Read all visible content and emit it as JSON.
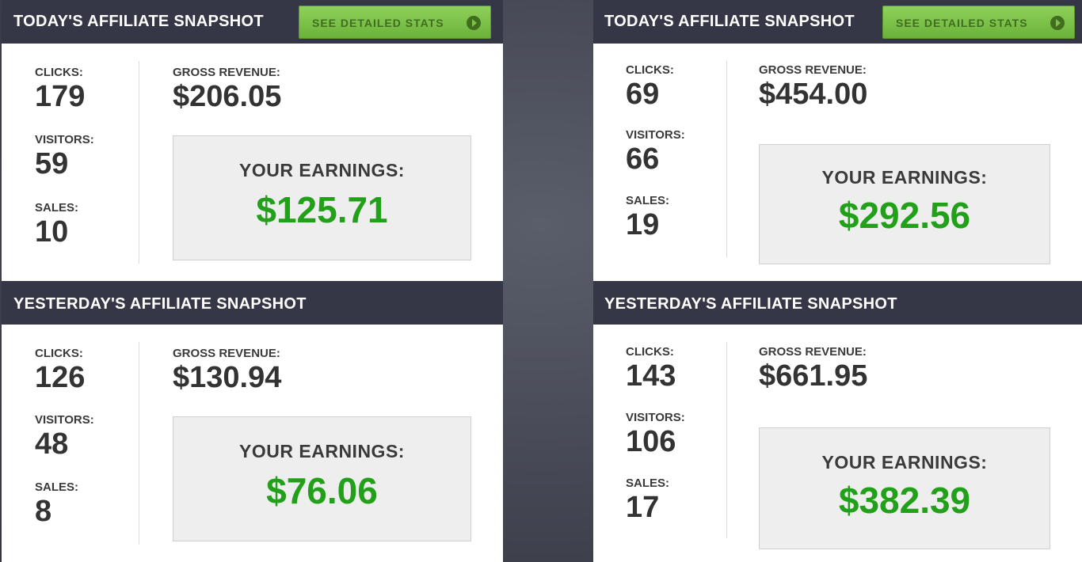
{
  "panels": {
    "left_today": {
      "title": "TODAY'S AFFILIATE SNAPSHOT",
      "button_label": "SEE DETAILED STATS",
      "clicks_label": "CLICKS:",
      "clicks": "179",
      "visitors_label": "VISITORS:",
      "visitors": "59",
      "sales_label": "SALES:",
      "sales": "10",
      "gross_label": "GROSS REVENUE:",
      "gross": "$206.05",
      "earnings_label": "YOUR EARNINGS:",
      "earnings": "$125.71"
    },
    "left_yesterday": {
      "title": "YESTERDAY'S AFFILIATE SNAPSHOT",
      "clicks_label": "CLICKS:",
      "clicks": "126",
      "visitors_label": "VISITORS:",
      "visitors": "48",
      "sales_label": "SALES:",
      "sales": "8",
      "gross_label": "GROSS REVENUE:",
      "gross": "$130.94",
      "earnings_label": "YOUR EARNINGS:",
      "earnings": "$76.06"
    },
    "right_today": {
      "title": "TODAY'S AFFILIATE SNAPSHOT",
      "button_label": "SEE DETAILED STATS",
      "clicks_label": "CLICKS:",
      "clicks": "69",
      "visitors_label": "VISITORS:",
      "visitors": "66",
      "sales_label": "SALES:",
      "sales": "19",
      "gross_label": "GROSS REVENUE:",
      "gross": "$454.00",
      "earnings_label": "YOUR EARNINGS:",
      "earnings": "$292.56"
    },
    "right_yesterday": {
      "title": "YESTERDAY'S AFFILIATE SNAPSHOT",
      "clicks_label": "CLICKS:",
      "clicks": "143",
      "visitors_label": "VISITORS:",
      "visitors": "106",
      "sales_label": "SALES:",
      "sales": "17",
      "gross_label": "GROSS REVENUE:",
      "gross": "$661.95",
      "earnings_label": "YOUR EARNINGS:",
      "earnings": "$382.39"
    }
  },
  "icons": {
    "button_icon": "arrow-circle-right-icon"
  },
  "colors": {
    "header_bg": "#363746",
    "button_green": "#7ec04a",
    "earnings_green": "#22a01a",
    "background": "#4a4d58"
  }
}
